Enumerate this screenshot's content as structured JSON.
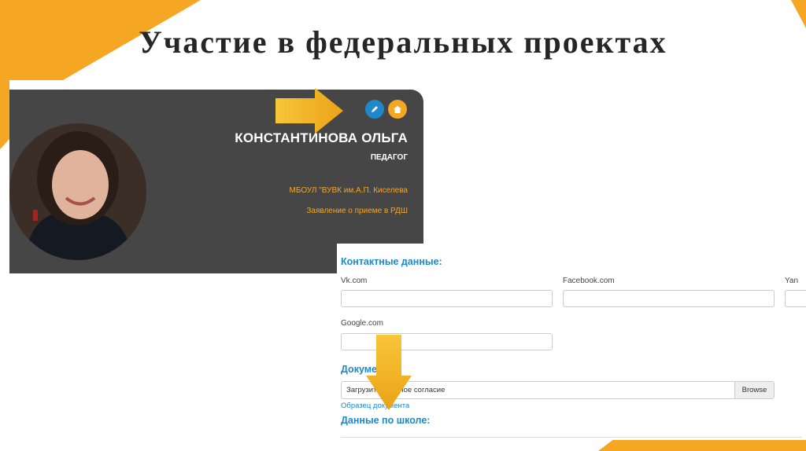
{
  "slide": {
    "title": "Участие в федеральных проектах",
    "accent_color": "#f5a623"
  },
  "profile": {
    "name": "КОНСТАНТИНОВА ОЛЬГА",
    "role": "ПЕДАГОГ",
    "school": "МБОУЛ \"ВУВК им.А.П. Киселева",
    "application_link": "Заявление о приеме в РДШ",
    "edit_icon": "pencil-icon",
    "home_icon": "house-icon"
  },
  "form": {
    "contacts_heading": "Контактные данные:",
    "vk_label": "Vk.com",
    "facebook_label": "Facebook.com",
    "third_label_partial": "Yan",
    "google_label": "Google.com",
    "documents_heading": "Докумен",
    "file_text": "Загрузит          ональное согласие",
    "browse_label": "Browse",
    "sample_link": "Образец документа",
    "school_heading": "Данные по школе:"
  },
  "colors": {
    "link_blue": "#1e88c9",
    "card_dark": "#464646",
    "orange": "#f5a623"
  }
}
